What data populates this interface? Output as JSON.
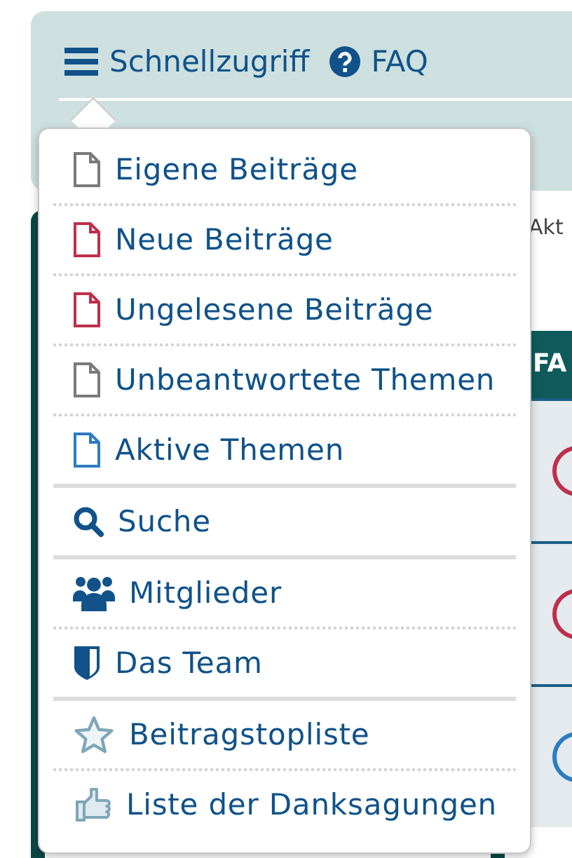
{
  "nav": {
    "quick_access": "Schnellzugriff",
    "faq": "FAQ"
  },
  "menu": {
    "groups": [
      {
        "items": [
          {
            "label": "Eigene Beiträge",
            "kind": "document",
            "color": "#7a7a7a"
          },
          {
            "label": "Neue Beiträge",
            "kind": "document",
            "color": "#bf2f4b"
          },
          {
            "label": "Ungelesene Beiträge",
            "kind": "document",
            "color": "#bf2f4b"
          },
          {
            "label": "Unbeantwortete Themen",
            "kind": "document",
            "color": "#7a7a7a"
          },
          {
            "label": "Aktive Themen",
            "kind": "document",
            "color": "#2d7cc1"
          }
        ]
      },
      {
        "items": [
          {
            "label": "Suche",
            "kind": "search"
          }
        ]
      },
      {
        "items": [
          {
            "label": "Mitglieder",
            "kind": "members"
          },
          {
            "label": "Das Team",
            "kind": "shield"
          }
        ]
      },
      {
        "items": [
          {
            "label": "Beitragstopliste",
            "kind": "star"
          },
          {
            "label": "Liste der Danksagungen",
            "kind": "thumb"
          }
        ]
      }
    ]
  },
  "side": {
    "label": "Akt",
    "header": "FA",
    "rows": [
      {
        "color": "#bf2f4b"
      },
      {
        "color": "#bf2f4b"
      },
      {
        "color": "#2d7cc1"
      }
    ]
  }
}
